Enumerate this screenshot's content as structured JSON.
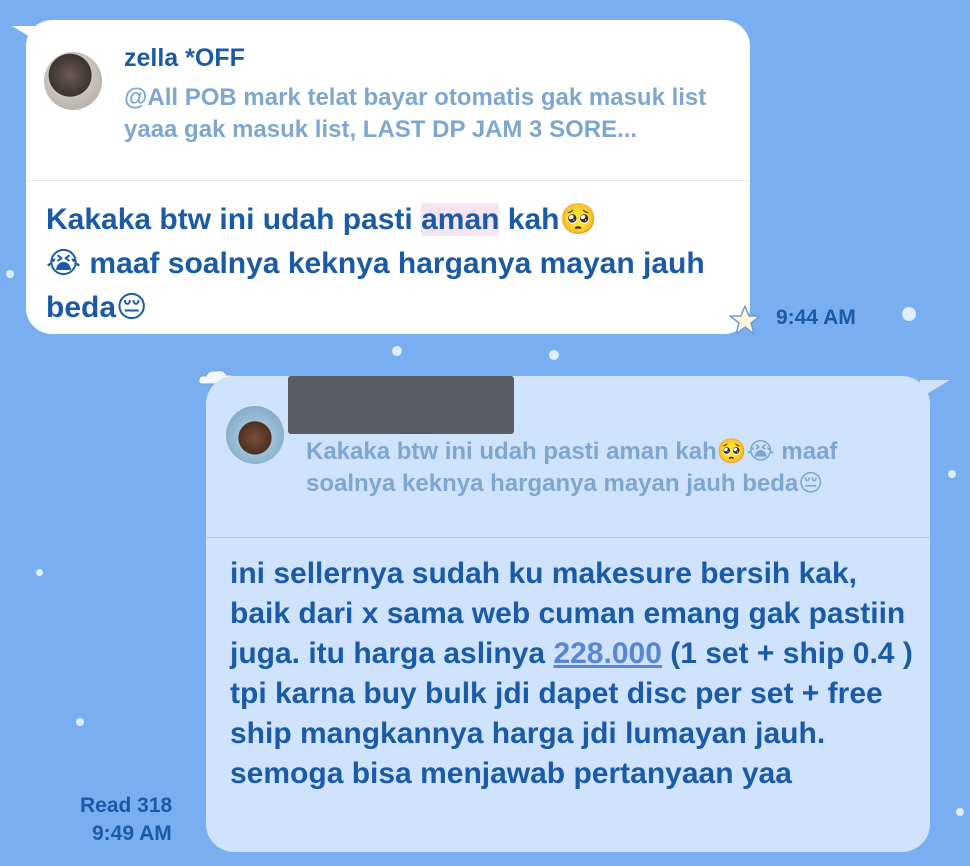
{
  "incoming": {
    "quote_name": "zella *OFF",
    "quote_text": "@All POB mark telat bayar otomatis gak masuk list yaaa gak masuk list, LAST DP JAM 3 SORE...",
    "message_before": "Kakaka btw ini udah pasti ",
    "message_highlight": "aman",
    "message_after": " kah🥺\n😭 maaf soalnya keknya harganya mayan jauh beda😔",
    "time": "9:44 AM"
  },
  "outgoing": {
    "quote_text": "Kakaka btw ini udah pasti aman kah🥺😭 maaf soalnya keknya harganya mayan jauh beda😔",
    "message_before": "ini sellernya sudah ku makesure bersih kak, baik dari x sama web cuman emang gak pastiin juga. itu harga aslinya ",
    "message_link": "228.000",
    "message_after": " (1 set + ship 0.4 ) tpi karna buy bulk jdi dapet disc per set + free ship mangkannya harga jdi lumayan jauh. semoga bisa menjawab pertanyaan yaa",
    "read_status": "Read 318",
    "time": "9:49 AM"
  },
  "colors": {
    "background": "#79aef0",
    "incoming_bubble": "#ffffff",
    "outgoing_bubble": "#cfe3fd",
    "text": "#1b5aa6",
    "quote_text": "#7fa6cf",
    "link": "#5a85d6"
  },
  "icons": {
    "star": "star-icon",
    "cloud": "cloud-icon"
  }
}
